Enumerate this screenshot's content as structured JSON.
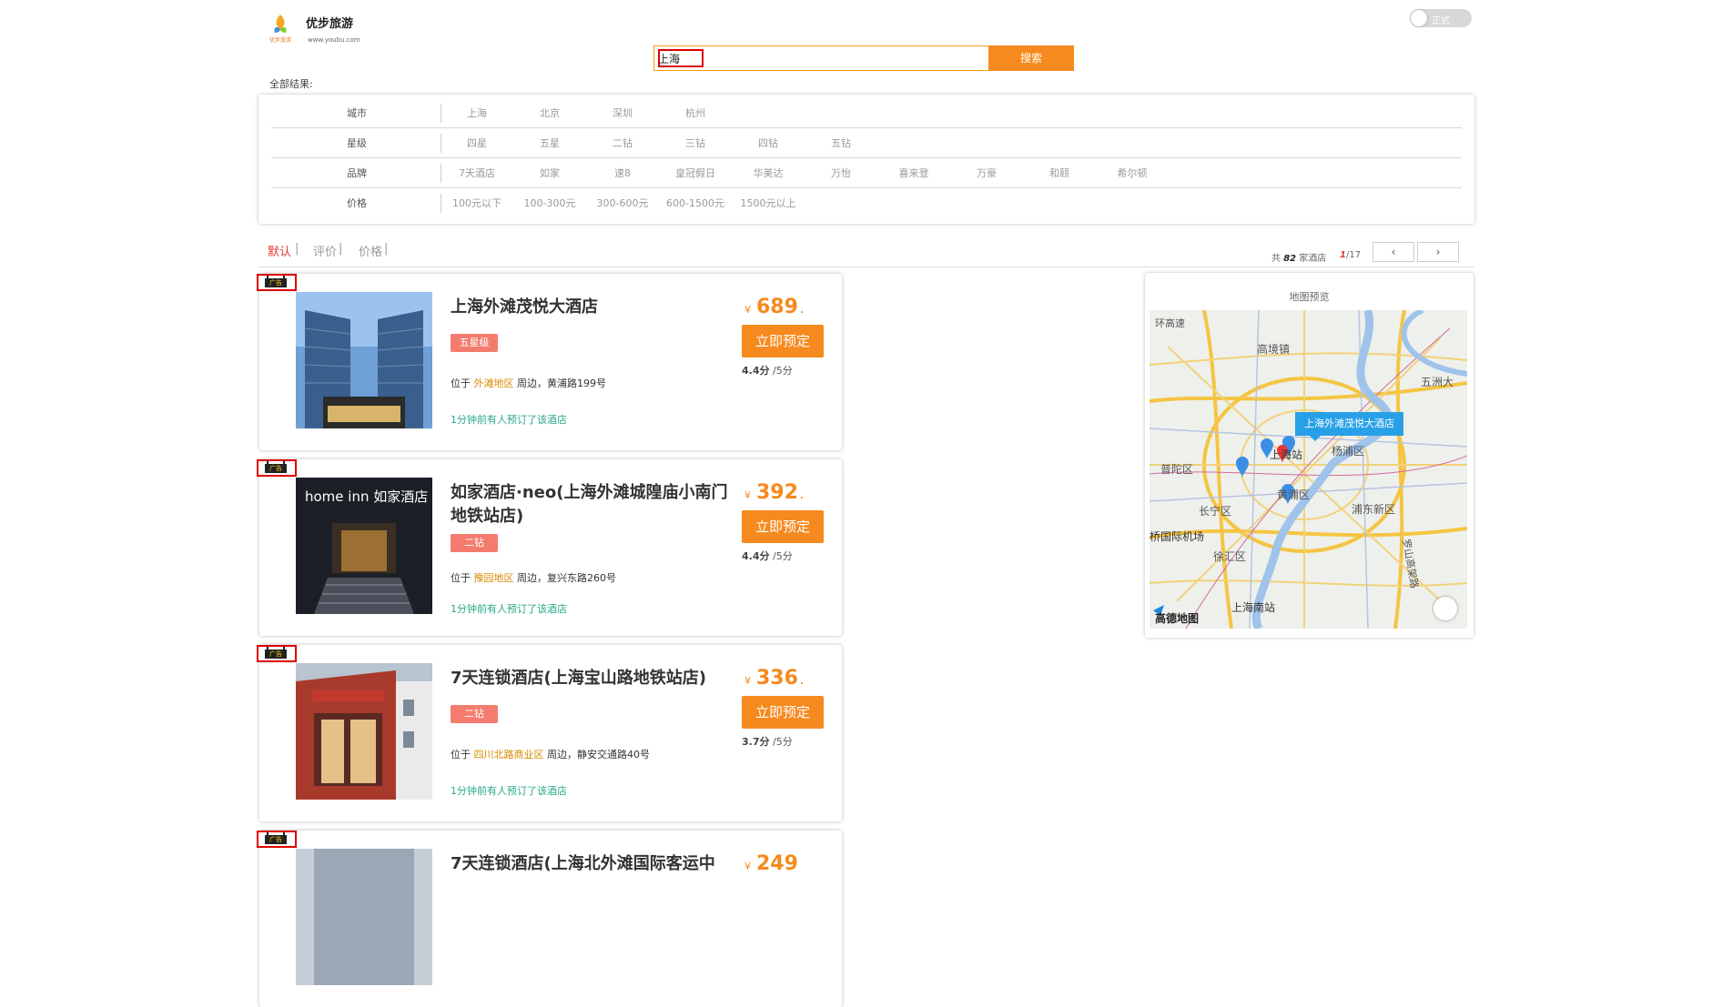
{
  "header": {
    "brand_name": "优步旅游",
    "brand_url": "www.youbu.com",
    "logo_text": "优步旅游",
    "toggle_label": "正式"
  },
  "search": {
    "value": "上海",
    "button_label": "搜索"
  },
  "all_results_label": "全部结果:",
  "filters": [
    {
      "label": "城市",
      "options": [
        "上海",
        "北京",
        "深圳",
        "杭州"
      ]
    },
    {
      "label": "星级",
      "options": [
        "四星",
        "五星",
        "二钻",
        "三钻",
        "四钻",
        "五钻"
      ]
    },
    {
      "label": "品牌",
      "options": [
        "7天酒店",
        "如家",
        "速8",
        "皇冠假日",
        "华美达",
        "万怡",
        "喜来登",
        "万豪",
        "和颐",
        "希尔顿"
      ]
    },
    {
      "label": "价格",
      "options": [
        "100元以下",
        "100-300元",
        "300-600元",
        "600-1500元",
        "1500元以上"
      ]
    }
  ],
  "sort": {
    "items": [
      "默认",
      "评价",
      "价格"
    ],
    "separator": "|",
    "result_prefix": "共",
    "result_count": "82",
    "result_suffix": "家酒店",
    "page_current": "1",
    "page_total": "/17",
    "prev_label": "‹",
    "next_label": "›"
  },
  "ad_label": "广告",
  "hotels": [
    {
      "name": "上海外滩茂悦大酒店",
      "star": "五星级",
      "location_prefix": "位于",
      "district": "外滩地区",
      "location_suffix": "周边，黄浦路199号",
      "recent": "1分钟前有人预订了该酒店",
      "currency": "¥",
      "price": "689",
      "price_dot": ".",
      "book_label": "立即预定",
      "score": "4.4分",
      "score_suffix": "/5分"
    },
    {
      "name": "如家酒店·neo(上海外滩城隍庙小南门地铁站店)",
      "star": "二钻",
      "location_prefix": "位于",
      "district": "豫园地区",
      "location_suffix": "周边，复兴东路260号",
      "recent": "1分钟前有人预订了该酒店",
      "currency": "¥",
      "price": "392",
      "price_dot": ".",
      "book_label": "立即预定",
      "score": "4.4分",
      "score_suffix": "/5分",
      "image_sign": "home inn 如家酒店"
    },
    {
      "name": "7天连锁酒店(上海宝山路地铁站店)",
      "star": "二钻",
      "location_prefix": "位于",
      "district": "四川北路商业区",
      "location_suffix": "周边，静安交通路40号",
      "recent": "1分钟前有人预订了该酒店",
      "currency": "¥",
      "price": "336",
      "price_dot": ".",
      "book_label": "立即预定",
      "score": "3.7分",
      "score_suffix": "/5分"
    },
    {
      "name": "7天连锁酒店(上海北外滩国际客运中",
      "currency": "¥",
      "price": "249"
    }
  ],
  "map": {
    "title": "地图预览",
    "tooltip": "上海外滩茂悦大酒店",
    "labels": [
      "环高速",
      "高境镇",
      "五洲大",
      "上海站",
      "杨浦区",
      "普陀区",
      "黄浦区",
      "长宁区",
      "浦东新区",
      "桥国际机场",
      "徐汇区",
      "上海南站",
      "罗山高架路"
    ],
    "logo": "高德地图"
  }
}
